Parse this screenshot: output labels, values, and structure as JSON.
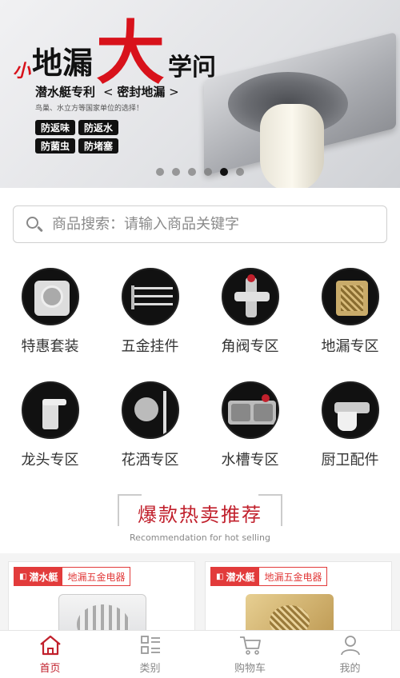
{
  "banner": {
    "prefix": "小",
    "headline_a": "地漏",
    "headline_big": "大",
    "headline_b": "学问",
    "subtitle_brand": "潜水艇专利",
    "subtitle_topic": "密封地漏",
    "description": "鸟巢、水立方等国家单位的选择！",
    "tags": [
      "防返味",
      "防返水",
      "防菌虫",
      "防堵塞"
    ],
    "dots_count": 6,
    "active_dot": 4
  },
  "search": {
    "placeholder": "商品搜索：请输入商品关键字"
  },
  "categories": [
    {
      "label": "特惠套装",
      "icon": "floor-drain-set-icon"
    },
    {
      "label": "五金挂件",
      "icon": "towel-rack-icon"
    },
    {
      "label": "角阀专区",
      "icon": "angle-valve-icon"
    },
    {
      "label": "地漏专区",
      "icon": "floor-drain-icon"
    },
    {
      "label": "龙头专区",
      "icon": "faucet-icon"
    },
    {
      "label": "花洒专区",
      "icon": "shower-icon"
    },
    {
      "label": "水槽专区",
      "icon": "sink-icon"
    },
    {
      "label": "厨卫配件",
      "icon": "fitting-icon"
    }
  ],
  "hot": {
    "title": "爆款热卖推荐",
    "subtitle": "Recommendation for hot selling"
  },
  "products": [
    {
      "brand": "潜水艇",
      "category": "地漏五金电器"
    },
    {
      "brand": "潜水艇",
      "category": "地漏五金电器"
    }
  ],
  "tabbar": [
    {
      "label": "首页",
      "icon": "home-icon",
      "active": true
    },
    {
      "label": "类别",
      "icon": "category-icon",
      "active": false
    },
    {
      "label": "购物车",
      "icon": "cart-icon",
      "active": false
    },
    {
      "label": "我的",
      "icon": "profile-icon",
      "active": false
    }
  ],
  "colors": {
    "accent": "#c1202c",
    "banner_red": "#d8121b"
  }
}
